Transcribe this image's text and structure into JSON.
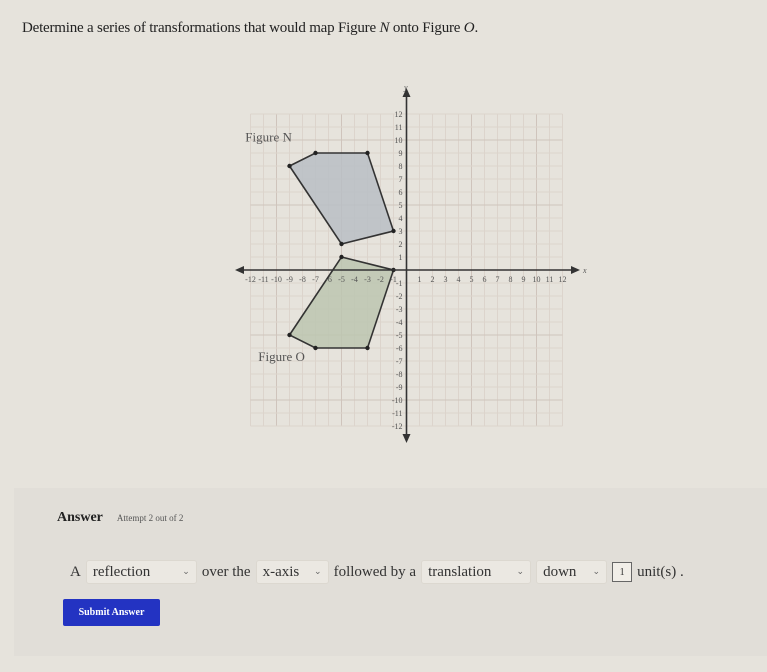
{
  "question": {
    "prefix": "Determine a series of transformations that would map Figure ",
    "figure_from": "N",
    "middle": " onto Figure ",
    "figure_to": "O",
    "suffix": "."
  },
  "graph": {
    "x_axis_label": "x",
    "y_axis_label": "y",
    "x_range": [
      -12,
      12
    ],
    "y_range": [
      -12,
      12
    ],
    "x_ticks": [
      -12,
      -11,
      -10,
      -9,
      -8,
      -7,
      -6,
      -5,
      -4,
      -3,
      -2,
      -1,
      1,
      2,
      3,
      4,
      5,
      6,
      7,
      8,
      9,
      10,
      11,
      12
    ],
    "y_ticks": [
      -12,
      -11,
      -10,
      -9,
      -8,
      -7,
      -6,
      -5,
      -4,
      -3,
      -2,
      -1,
      1,
      2,
      3,
      4,
      5,
      6,
      7,
      8,
      9,
      10,
      11,
      12
    ],
    "figures": [
      {
        "name": "Figure N",
        "vertices": [
          [
            -9,
            8
          ],
          [
            -7,
            9
          ],
          [
            -3,
            9
          ],
          [
            -1,
            3
          ],
          [
            -5,
            2
          ]
        ],
        "fill": "#b9bec4",
        "label_position": [
          -12.4,
          9.9
        ]
      },
      {
        "name": "Figure O",
        "vertices": [
          [
            -5,
            1
          ],
          [
            -1,
            0
          ],
          [
            -3,
            -6
          ],
          [
            -7,
            -6
          ],
          [
            -9,
            -5
          ]
        ],
        "fill": "#bcc6b0",
        "label_position": [
          -11.4,
          -7
        ]
      }
    ]
  },
  "answer": {
    "title": "Answer",
    "attempt": "Attempt 2 out of 2",
    "word_a": "A",
    "transformation_1": "reflection",
    "over_the": "over the",
    "axis": "x-axis",
    "followed_by": "followed by a",
    "transformation_2": "translation",
    "direction": "down",
    "units_value": "1",
    "units_label": "unit(s) .",
    "submit_label": "Submit Answer",
    "submit_color": "#2333c2"
  }
}
